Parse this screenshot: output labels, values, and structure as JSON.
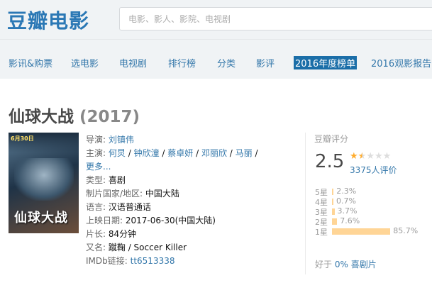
{
  "header": {
    "logo": "豆瓣电影",
    "search_placeholder": "电影、影人、影院、电视剧"
  },
  "nav": {
    "items": [
      "影讯&购票",
      "选电影",
      "电视剧",
      "排行榜",
      "分类",
      "影评",
      "2016年度榜单",
      "2016观影报告"
    ],
    "active_index": 6
  },
  "movie": {
    "title": "仙球大战",
    "year": "(2017)",
    "poster": {
      "date_text": "6月30日",
      "title_text": "仙球大战"
    },
    "info": {
      "director_label": "导演:",
      "director": "刘镇伟",
      "cast_label": "主演:",
      "cast": [
        "何炅",
        "钟欣潼",
        "蔡卓妍",
        "邓丽欣",
        "马丽"
      ],
      "cast_more": "更多...",
      "genre_label": "类型:",
      "genre": "喜剧",
      "country_label": "制片国家/地区:",
      "country": "中国大陆",
      "language_label": "语言:",
      "language": "汉语普通话",
      "release_label": "上映日期:",
      "release": "2017-06-30(中国大陆)",
      "runtime_label": "片长:",
      "runtime": "84分钟",
      "aka_label": "又名:",
      "aka": "蹴鞠 / Soccer Killer",
      "imdb_label": "IMDb链接:",
      "imdb": "tt6513338"
    }
  },
  "rating": {
    "label": "豆瓣评分",
    "score": "2.5",
    "stars_filled": 1.5,
    "votes": "3375人评价",
    "distribution": [
      {
        "label": "5星",
        "percent": 2.3,
        "text": "2.3%"
      },
      {
        "label": "4星",
        "percent": 0.7,
        "text": "0.7%"
      },
      {
        "label": "3星",
        "percent": 3.7,
        "text": "3.7%"
      },
      {
        "label": "2星",
        "percent": 7.6,
        "text": "7.6%"
      },
      {
        "label": "1星",
        "percent": 85.7,
        "text": "85.7%"
      }
    ],
    "better_prefix": "好于",
    "better_link": "0% 喜剧片"
  },
  "colors": {
    "link": "#3377aa",
    "logo": "#2b78b5",
    "nav_active_bg": "#1b6ea8",
    "star": "#ffac2d",
    "bar": "#ffd596"
  }
}
